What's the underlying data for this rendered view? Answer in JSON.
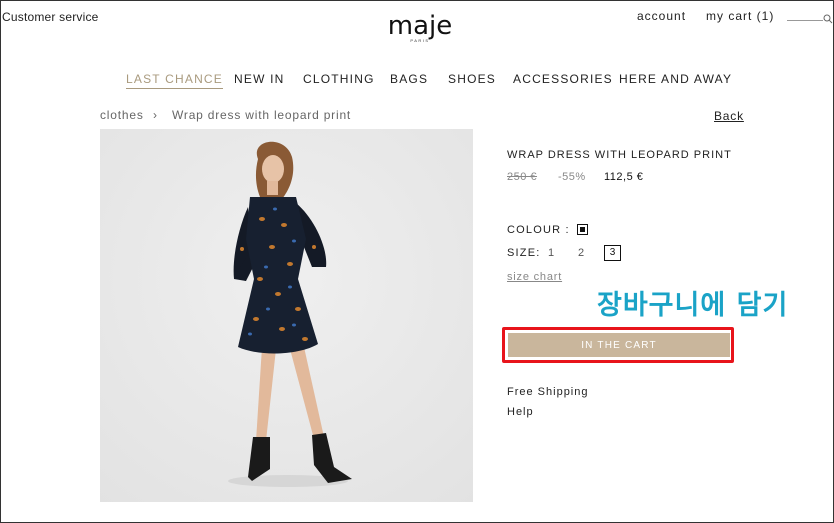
{
  "header": {
    "customer_service": "Customer service",
    "logo": "maje",
    "logo_sub": "PARIS",
    "account": "account",
    "my_cart": "my cart (1)"
  },
  "nav": {
    "items": [
      {
        "label": "LAST CHANCE",
        "active": true
      },
      {
        "label": "NEW IN"
      },
      {
        "label": "CLOTHING"
      },
      {
        "label": "BAGS"
      },
      {
        "label": "SHOES"
      },
      {
        "label": "ACCESSORIES"
      },
      {
        "label": "HERE AND AWAY"
      }
    ]
  },
  "breadcrumb": {
    "parent": "clothes",
    "separator": "›",
    "current": "Wrap dress with leopard print"
  },
  "back_label": "Back",
  "product": {
    "title": "WRAP DRESS WITH LEOPARD PRINT",
    "price_old": "250 €",
    "discount": "-55%",
    "price_new": "112,5 €",
    "colour_label": "COLOUR :",
    "size_label": "SIZE:",
    "sizes": [
      "1",
      "2",
      "3"
    ],
    "selected_size": "3",
    "size_chart": "size chart",
    "add_to_cart": "IN THE CART",
    "free_shipping": "Free Shipping",
    "help": "Help"
  },
  "annotation": "장바구니에 담기",
  "colors": {
    "accent_nav": "#a99a7e",
    "cart_button": "#c9b69c",
    "highlight_box": "#e8141b",
    "annotation_text": "#1aa3c7"
  },
  "icons": {
    "search": "search-icon",
    "swatch": "colour-swatch-icon"
  }
}
